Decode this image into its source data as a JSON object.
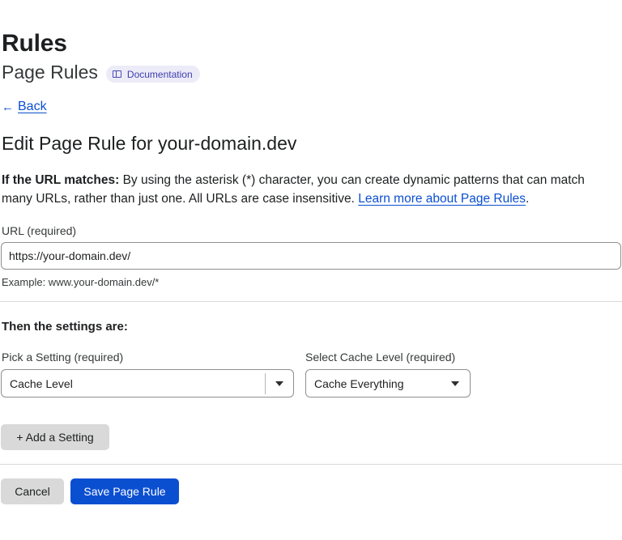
{
  "header": {
    "title": "Rules",
    "subtitle": "Page Rules",
    "doc_badge": "Documentation"
  },
  "nav": {
    "back_arrow": "←",
    "back_label": "Back"
  },
  "form": {
    "heading": "Edit Page Rule for your-domain.dev",
    "description": {
      "lead": "If the URL matches:",
      "body": " By using the asterisk (*) character, you can create dynamic patterns that can match many URLs, rather than just one. All URLs are case insensitive. ",
      "link": "Learn more about Page Rules",
      "tail": "."
    },
    "url": {
      "label": "URL (required)",
      "value": "https://your-domain.dev/",
      "hint": "Example: www.your-domain.dev/*"
    },
    "settings": {
      "heading": "Then the settings are:",
      "setting_label": "Pick a Setting (required)",
      "setting_value": "Cache Level",
      "cache_label": "Select Cache Level (required)",
      "cache_value": "Cache Everything"
    },
    "buttons": {
      "add_setting": "+ Add a Setting",
      "cancel": "Cancel",
      "save": "Save Page Rule"
    }
  },
  "colors": {
    "accent": "#0b4fd1",
    "badge_bg": "#ecebf8",
    "button_gray": "#d9d9d9"
  },
  "icons": {
    "doc_badge": "book-icon",
    "back": "arrow-left-icon",
    "dropdown": "caret-down-icon"
  }
}
